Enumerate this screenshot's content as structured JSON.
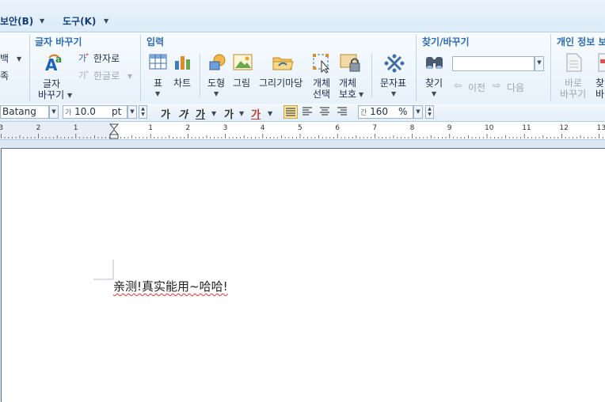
{
  "menu": {
    "security_label": "보안(B)",
    "tools_label": "도구(K)"
  },
  "ribbon": {
    "left_partial": {
      "blank_label": "백",
      "row2_label": "족"
    },
    "char_replace": {
      "title": "글자 바꾸기",
      "char_change_line1": "글자",
      "char_change_line2": "바꾸기",
      "to_hanja": "한자로",
      "to_hangul": "한글로"
    },
    "insert": {
      "title": "입력",
      "table": "표",
      "chart": "차트",
      "shape": "도형",
      "picture": "그림",
      "drawing": "그리기마당",
      "obj_select_line1": "개체",
      "obj_select_line2": "선택",
      "obj_protect_line1": "개체",
      "obj_protect_line2": "보호"
    },
    "charmap": {
      "label": "문자표"
    },
    "find_replace": {
      "title": "찾기/바꾸기",
      "find": "찾기",
      "search_value": "",
      "prev": "이전",
      "next": "다음"
    },
    "privacy": {
      "title": "개인 정보 보",
      "shortcut_line1": "바로",
      "shortcut_line2": "바꾸기",
      "find_line1": "찾",
      "find_line2": "바"
    }
  },
  "format": {
    "font": "Batang",
    "size_prefix": "가",
    "size": "10.0",
    "size_unit": "pt",
    "bold": "가",
    "italic": "가",
    "underline": "가",
    "strike": "가",
    "color_char": "가",
    "line_spacing_prefix": "간",
    "line_spacing": "160",
    "line_spacing_unit": "%"
  },
  "ruler": {
    "ticks": [
      "3",
      "2",
      "1",
      "1",
      "2",
      "3",
      "4",
      "5",
      "6",
      "7",
      "8",
      "9",
      "10",
      "11",
      "12",
      "13"
    ]
  },
  "document": {
    "text": "亲测!真实能用~哈哈!"
  },
  "colors": {
    "accent": "#2f6cb0",
    "menu_text": "#123e75",
    "spell_underline": "#d33"
  }
}
